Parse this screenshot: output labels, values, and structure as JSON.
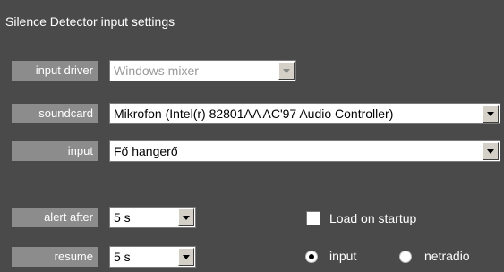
{
  "title": "Silence Detector input settings",
  "fields": {
    "input_driver": {
      "label": "input driver",
      "value": "Windows mixer",
      "disabled": true
    },
    "soundcard": {
      "label": "soundcard",
      "value": "Mikrofon (Intel(r) 82801AA AC'97 Audio Controller)"
    },
    "input": {
      "label": "input",
      "value": "Fő hangerő"
    },
    "alert_after": {
      "label": "alert after",
      "value": "5 s"
    },
    "resume": {
      "label": "resume",
      "value": "5 s"
    }
  },
  "load_on_startup": {
    "label": "Load on startup",
    "checked": false
  },
  "source": {
    "options": [
      {
        "label": "input",
        "selected": true
      },
      {
        "label": "netradio",
        "selected": false
      }
    ]
  }
}
